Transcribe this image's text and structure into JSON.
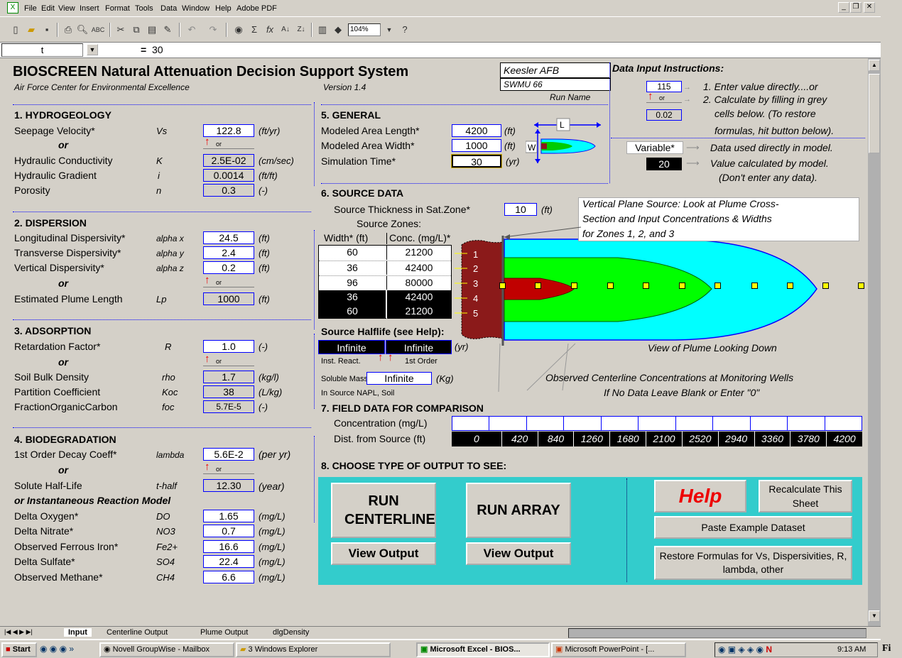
{
  "menu": [
    "File",
    "Edit",
    "View",
    "Insert",
    "Format",
    "Tools",
    "Data",
    "Window",
    "Help",
    "Adobe PDF"
  ],
  "toolbar": {
    "zoom": "104%"
  },
  "formula": {
    "cell": "t",
    "eq": "=",
    "value": "30"
  },
  "header": {
    "title": "BIOSCREEN Natural Attenuation Decision Support System",
    "org": "Air Force Center for Environmental Excellence",
    "version": "Version 1.4",
    "site": "Keesler AFB",
    "run": "SWMU 66",
    "run_label": "Run Name"
  },
  "instr": {
    "title": "Data Input Instructions:",
    "v1": "115",
    "or": "or",
    "v2": "0.02",
    "s1": "1.  Enter value directly....or",
    "s2": "2.  Calculate by filling in grey",
    "s3": "cells below.  (To restore",
    "s4": "formulas, hit button below).",
    "var": "Variable*",
    "var_desc": "Data used directly in model.",
    "calc": "20",
    "calc_desc": "Value calculated by model.",
    "calc_desc2": "(Don't enter any data)."
  },
  "hydro": {
    "head": "1. HYDROGEOLOGY",
    "vs_l": "Seepage Velocity*",
    "vs_s": "Vs",
    "vs_v": "122.8",
    "vs_u": "(ft/yr)",
    "or": "or",
    "k_l": "Hydraulic Conductivity",
    "k_s": "K",
    "k_v": "2.5E-02",
    "k_u": "(cm/sec)",
    "i_l": "Hydraulic Gradient",
    "i_s": "i",
    "i_v": "0.0014",
    "i_u": "(ft/ft)",
    "n_l": "Porosity",
    "n_s": "n",
    "n_v": "0.3",
    "n_u": "(-)"
  },
  "disp": {
    "head": "2. DISPERSION",
    "ax_l": "Longitudinal Dispersivity*",
    "ax_s": "alpha x",
    "ax_v": "24.5",
    "ax_u": "(ft)",
    "ay_l": "Transverse Dispersivity*",
    "ay_s": "alpha y",
    "ay_v": "2.4",
    "ay_u": "(ft)",
    "az_l": "Vertical Dispersivity*",
    "az_s": "alpha z",
    "az_v": "0.2",
    "az_u": "(ft)",
    "or": "or",
    "lp_l": "Estimated Plume Length",
    "lp_s": "Lp",
    "lp_v": "1000",
    "lp_u": "(ft)"
  },
  "ads": {
    "head": "3. ADSORPTION",
    "r_l": "Retardation Factor*",
    "r_s": "R",
    "r_v": "1.0",
    "r_u": "(-)",
    "or": "or",
    "rho_l": "Soil Bulk Density",
    "rho_s": "rho",
    "rho_v": "1.7",
    "rho_u": "(kg/l)",
    "koc_l": "Partition Coefficient",
    "koc_s": "Koc",
    "koc_v": "38",
    "koc_u": "(L/kg)",
    "foc_l": "FractionOrganicCarbon",
    "foc_s": "foc",
    "foc_v": "5.7E-5",
    "foc_u": "(-)"
  },
  "bio": {
    "head": "4. BIODEGRADATION",
    "lam_l": "1st Order Decay Coeff*",
    "lam_s": "lambda",
    "lam_v": "5.6E-2",
    "lam_u": "(per yr)",
    "or": "or",
    "hl_l": "Solute Half-Life",
    "hl_s": "t-half",
    "hl_v": "12.30",
    "hl_u": "(year)",
    "irm": "or Instantaneous Reaction Model",
    "do_l": "Delta Oxygen*",
    "do_s": "DO",
    "do_v": "1.65",
    "do_u": "(mg/L)",
    "no3_l": "Delta Nitrate*",
    "no3_s": "NO3",
    "no3_v": "0.7",
    "no3_u": "(mg/L)",
    "fe_l": "Observed Ferrous Iron*",
    "fe_s": "Fe2+",
    "fe_v": "16.6",
    "fe_u": "(mg/L)",
    "so4_l": "Delta Sulfate*",
    "so4_s": "SO4",
    "so4_v": "22.4",
    "so4_u": "(mg/L)",
    "ch4_l": "Observed Methane*",
    "ch4_s": "CH4",
    "ch4_v": "6.6",
    "ch4_u": "(mg/L)"
  },
  "gen": {
    "head": "5. GENERAL",
    "len_l": "Modeled Area Length*",
    "len_v": "4200",
    "len_u": "(ft)",
    "wid_l": "Modeled Area Width*",
    "wid_v": "1000",
    "wid_u": "(ft)",
    "time_l": "Simulation Time*",
    "time_v": "30",
    "time_u": "(yr)",
    "L": "L",
    "W": "W"
  },
  "src": {
    "head": "6. SOURCE DATA",
    "thick_l": "Source Thickness in Sat.Zone*",
    "thick_v": "10",
    "thick_u": "(ft)",
    "zones": "Source Zones:",
    "col1": "Width* (ft)",
    "col2": "Conc. (mg/L)*",
    "rows": [
      {
        "w": "60",
        "c": "21200",
        "n": "1"
      },
      {
        "w": "36",
        "c": "42400",
        "n": "2"
      },
      {
        "w": "96",
        "c": "80000",
        "n": "3"
      },
      {
        "w": "36",
        "c": "42400",
        "n": "4"
      },
      {
        "w": "60",
        "c": "21200",
        "n": "5"
      }
    ],
    "hl_head": "Source Halflife (see Help):",
    "hl1": "Infinite",
    "hl2": "Infinite",
    "hl_u": "(yr)",
    "inst": "Inst. React.",
    "first": "1st Order",
    "sm_l": "Soluble Mass",
    "sm_v": "Infinite",
    "sm_u": "(Kg)",
    "napl": "In Source NAPL, Soil",
    "note1": "Vertical Plane Source:  Look at Plume Cross-",
    "note2": "Section and Input Concentrations & Widths",
    "note3": "for Zones 1, 2, and 3",
    "view": "View of Plume Looking Down",
    "obs1": "Observed Centerline Concentrations at Monitoring Wells",
    "obs2": "If No Data Leave Blank or Enter \"0\""
  },
  "field": {
    "head": "7. FIELD DATA FOR COMPARISON",
    "conc_l": "Concentration (mg/L)",
    "dist_l": "Dist. from Source  (ft)",
    "dist": [
      "0",
      "420",
      "840",
      "1260",
      "1680",
      "2100",
      "2520",
      "2940",
      "3360",
      "3780",
      "4200"
    ]
  },
  "out": {
    "head": "8. CHOOSE TYPE OF OUTPUT TO SEE:",
    "run_cl": "RUN CENTERLINE",
    "run_arr": "RUN ARRAY",
    "view1": "View Output",
    "view2": "View Output",
    "help": "Help",
    "recalc": "Recalculate This Sheet",
    "paste": "Paste Example Dataset",
    "restore": "Restore Formulas for Vs, Dispersivities, R,  lambda, other"
  },
  "tabs": [
    "Input",
    "Centerline Output",
    "Plume Output",
    "dlgDensity"
  ],
  "taskbar": {
    "start": "Start",
    "t1": "Novell GroupWise - Mailbox",
    "t2": "3 Windows Explorer",
    "t3": "Microsoft Excel - BIOS...",
    "t4": "Microsoft PowerPoint - [...",
    "clock": "9:13 AM",
    "trail": "Fi"
  }
}
